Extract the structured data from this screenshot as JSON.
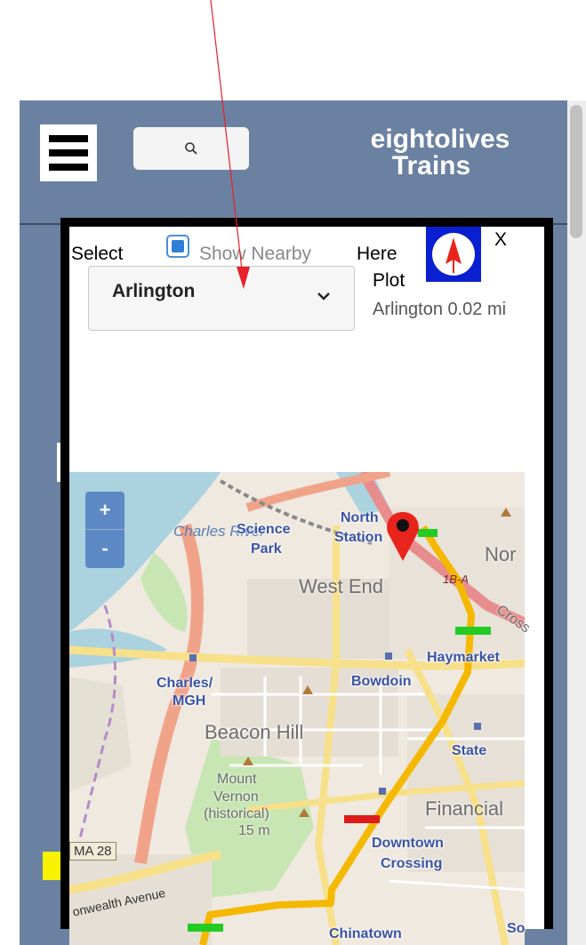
{
  "header": {
    "brand_line1": "eightolives",
    "brand_line2": "Trains",
    "search_icon": "search-icon",
    "menu_icon": "hamburger-menu-icon"
  },
  "dialog": {
    "select_label": "Select",
    "show_nearby_label": "Show Nearby",
    "show_nearby_checked": true,
    "here_label": "Here",
    "plot_label": "Plot",
    "distance_text": "Arlington 0.02 mi",
    "close_label": "X",
    "station_select": {
      "value": "Arlington"
    },
    "compass_icon": "compass-icon"
  },
  "map": {
    "zoom_in_label": "+",
    "zoom_out_label": "-",
    "labels": {
      "charles_river": "Charles River",
      "science": "Science",
      "park": "Park",
      "north": "North",
      "station": "Station",
      "nor": "Nor",
      "west_end": "West End",
      "route_1a": "1B-A",
      "cross": "Cross",
      "haymarket": "Haymarket",
      "charles_mgh_1": "Charles/",
      "charles_mgh_2": "MGH",
      "bowdoin": "Bowdoin",
      "beacon_hill": "Beacon Hill",
      "state": "State",
      "mount": "Mount",
      "vernon": "Vernon",
      "historical": "(historical)",
      "elevation": "15 m",
      "financial": "Financial",
      "downtown": "Downtown",
      "crossing": "Crossing",
      "ma28": "MA 28",
      "commonwealth": "onwealth Avenue",
      "chinatown": "Chinatown",
      "so": "So"
    }
  },
  "colors": {
    "app_background": "#6b81a1",
    "route_line": "#f5b800",
    "marker": "#e8241c",
    "compass_bg": "#0a1fd0"
  }
}
